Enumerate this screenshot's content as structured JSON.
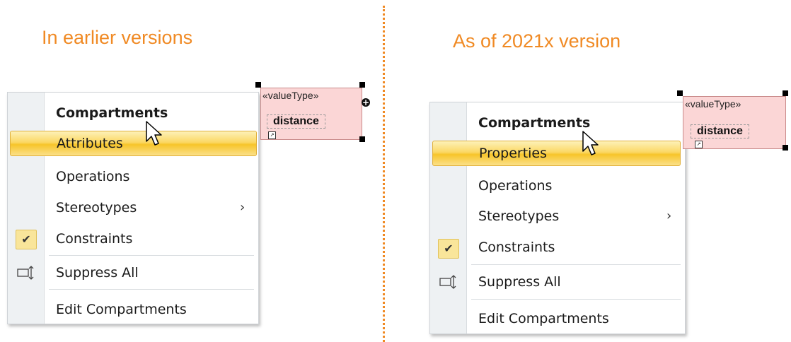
{
  "left": {
    "title": "In earlier versions",
    "menu": {
      "header": "Compartments",
      "items": [
        {
          "label": "Attributes",
          "highlighted": true
        },
        {
          "label": "Operations"
        },
        {
          "label": "Stereotypes",
          "submenu": true
        },
        {
          "label": "Constraints",
          "checked": true
        },
        {
          "label": "Suppress All",
          "icon": "suppress-icon"
        },
        {
          "label": "Edit Compartments"
        }
      ]
    },
    "shape": {
      "stereotype": "«valueType»",
      "name": "distance"
    }
  },
  "right": {
    "title": "As of 2021x version",
    "menu": {
      "header": "Compartments",
      "items": [
        {
          "label": "Properties",
          "highlighted": true
        },
        {
          "label": "Operations"
        },
        {
          "label": "Stereotypes",
          "submenu": true
        },
        {
          "label": "Constraints",
          "checked": true
        },
        {
          "label": "Suppress All",
          "icon": "suppress-icon"
        },
        {
          "label": "Edit Compartments"
        }
      ]
    },
    "shape": {
      "stereotype": "«valueType»",
      "name": "distance"
    }
  },
  "glyphs": {
    "submenu_arrow": "›",
    "check": "✔",
    "plus": "+",
    "mini": "↗"
  },
  "colors": {
    "title": "#f08a24",
    "highlight": "#fbd865",
    "shape_fill": "#fbd6d6"
  }
}
